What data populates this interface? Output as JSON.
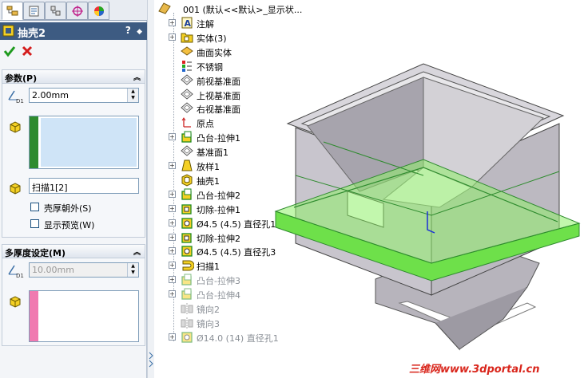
{
  "property_manager": {
    "title": "抽壳2",
    "help_label": "?",
    "pin_label": "◆",
    "params_group": {
      "title": "参数(P)",
      "thickness": "2.00mm",
      "faces_selected": "扫描1[2]",
      "shell_outward": "壳厚朝外(S)",
      "show_preview": "显示预览(W)"
    },
    "multi_group": {
      "title": "多厚度设定(M)",
      "thickness": "10.00mm"
    }
  },
  "tree": {
    "root": "001 (默认<<默认>_显示状...",
    "items": [
      {
        "label": "注解",
        "icon": "annotation-icon",
        "expand": "+"
      },
      {
        "label": "实体(3)",
        "icon": "solid-bodies-folder-icon",
        "expand": "+"
      },
      {
        "label": "曲面实体",
        "icon": "surface-bodies-icon",
        "expand": ""
      },
      {
        "label": "不锈钢",
        "icon": "material-icon",
        "expand": ""
      },
      {
        "label": "前视基准面",
        "icon": "plane-icon",
        "expand": ""
      },
      {
        "label": "上视基准面",
        "icon": "plane-icon",
        "expand": ""
      },
      {
        "label": "右视基准面",
        "icon": "plane-icon",
        "expand": ""
      },
      {
        "label": "原点",
        "icon": "origin-icon",
        "expand": ""
      },
      {
        "label": "凸台-拉伸1",
        "icon": "extrude-boss-icon",
        "expand": "+"
      },
      {
        "label": "基准面1",
        "icon": "plane-icon",
        "expand": ""
      },
      {
        "label": "放样1",
        "icon": "loft-icon",
        "expand": "+"
      },
      {
        "label": "抽壳1",
        "icon": "shell-icon",
        "expand": ""
      },
      {
        "label": "凸台-拉伸2",
        "icon": "extrude-boss-icon",
        "expand": "+"
      },
      {
        "label": "切除-拉伸1",
        "icon": "extrude-cut-icon",
        "expand": "+"
      },
      {
        "label": "Ø4.5 (4.5) 直径孔1",
        "icon": "hole-icon",
        "expand": "+"
      },
      {
        "label": "切除-拉伸2",
        "icon": "extrude-cut-icon",
        "expand": "+"
      },
      {
        "label": "Ø4.5 (4.5) 直径孔3",
        "icon": "hole-icon",
        "expand": "+"
      },
      {
        "label": "扫描1",
        "icon": "sweep-icon",
        "expand": "+"
      },
      {
        "label": "凸台-拉伸3",
        "icon": "extrude-boss-icon",
        "expand": "+",
        "dim": true
      },
      {
        "label": "凸台-拉伸4",
        "icon": "extrude-boss-icon",
        "expand": "+",
        "dim": true
      },
      {
        "label": "镜向2",
        "icon": "mirror-icon",
        "expand": "",
        "dim": true
      },
      {
        "label": "镜向3",
        "icon": "mirror-icon",
        "expand": "",
        "dim": true
      },
      {
        "label": "Ø14.0 (14) 直径孔1",
        "icon": "hole-icon",
        "expand": "+",
        "dim": true
      }
    ]
  },
  "watermark": "三维网www.3dportal.cn",
  "colors": {
    "title_bar": "#3d5b82",
    "selection_green": "#2e8b2e",
    "selection_box": "#cfe4f7",
    "pink_stripe": "#f07ab0",
    "highlight_green": "#6ee04a"
  }
}
